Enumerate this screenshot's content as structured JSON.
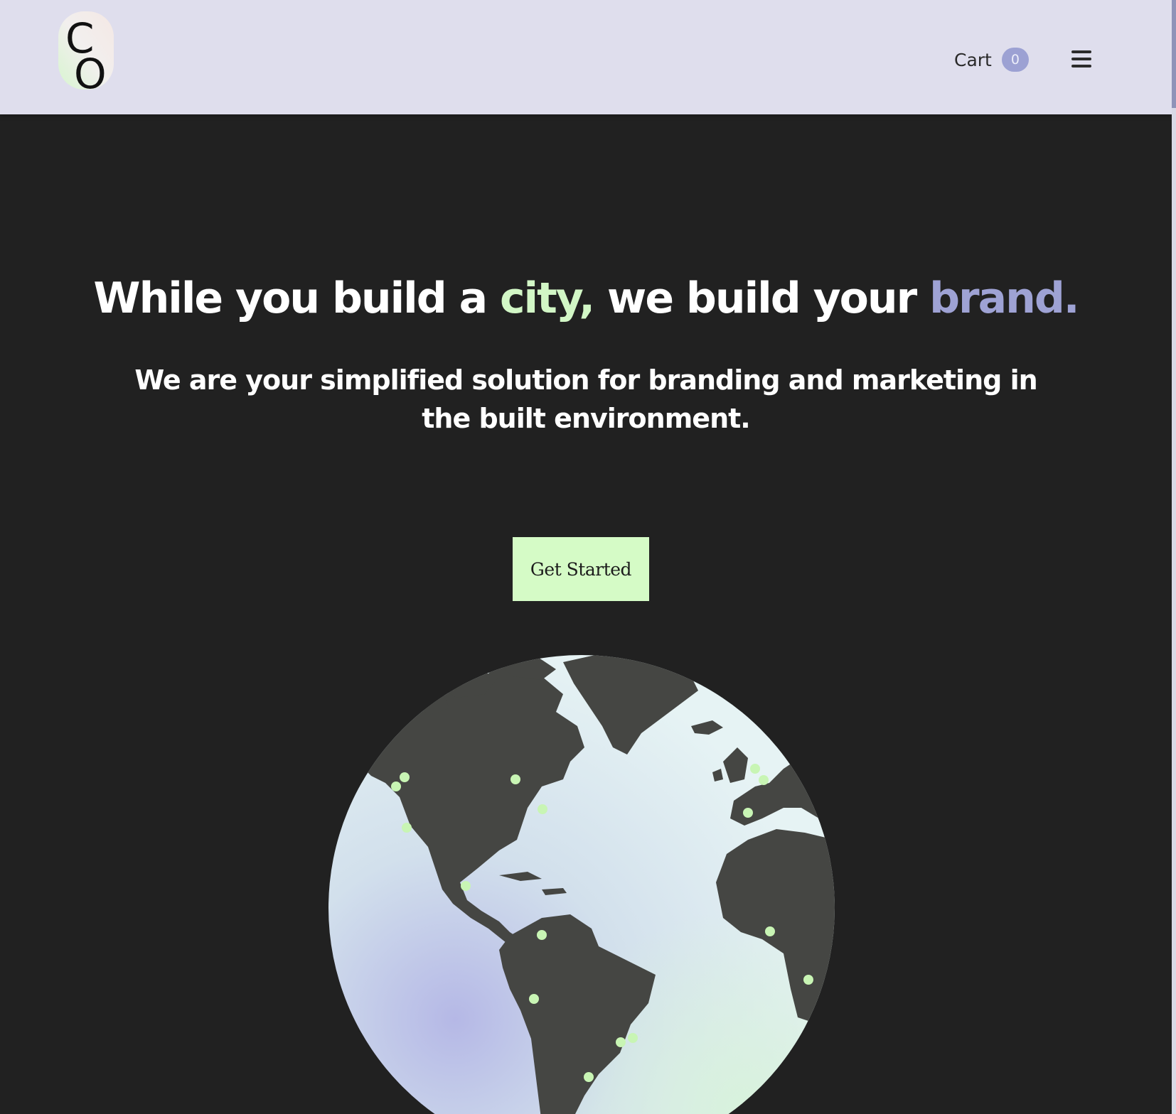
{
  "header": {
    "logo_letters": [
      "C",
      "O"
    ],
    "cart_label": "Cart",
    "cart_count": "0",
    "menu_icon": "hamburger-icon"
  },
  "hero": {
    "title_part1": "While you build a ",
    "title_highlight1": "city,",
    "title_part2": " we build your ",
    "title_highlight2": "brand.",
    "subtitle": "We are your simplified solution for branding and marketing in the built environment.",
    "cta_label": "Get Started"
  },
  "colors": {
    "header_bg": "#dfdeed",
    "page_bg": "#212121",
    "accent_green": "#d2f7c6",
    "accent_purple": "#9ea2d4",
    "land": "#454643",
    "marker": "#c8f5b4"
  },
  "icons": [
    "logo-icon",
    "hamburger-icon",
    "globe-illustration"
  ]
}
